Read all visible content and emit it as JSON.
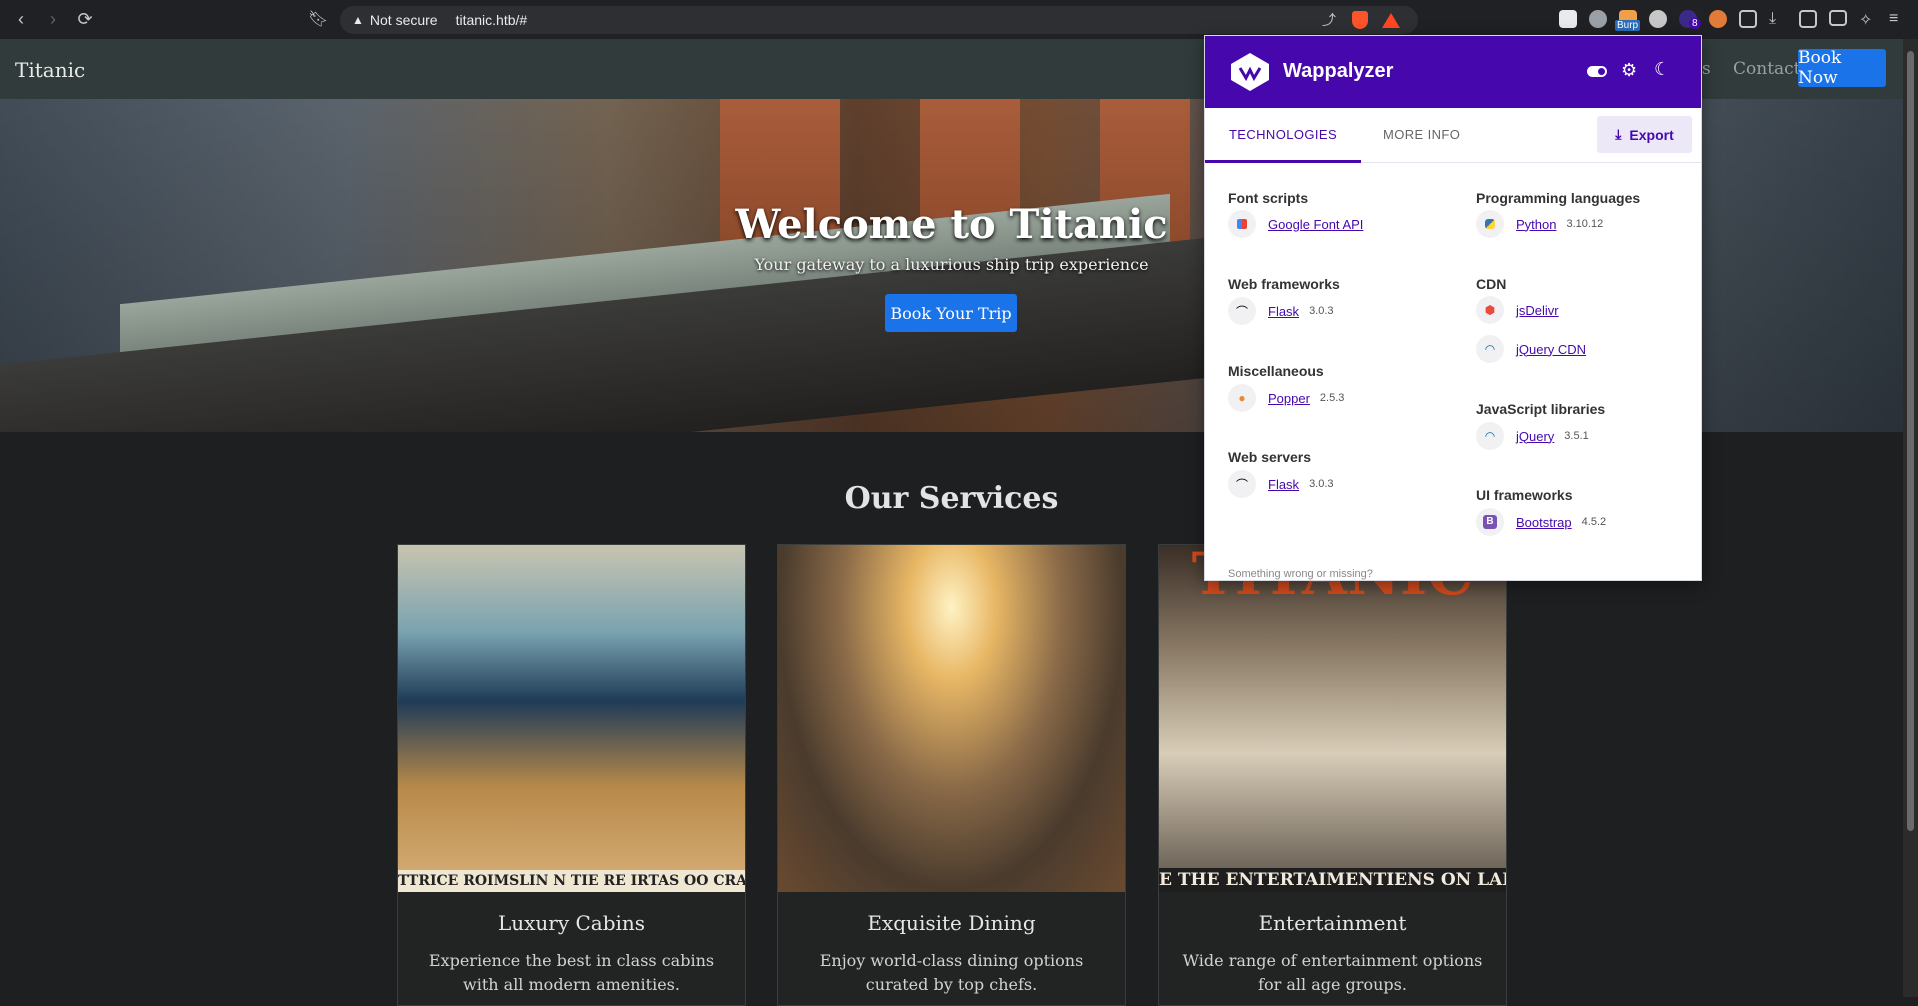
{
  "browser": {
    "security_label": "Not secure",
    "url": "titanic.htb/#",
    "ext_badge": "8",
    "ext_burp_label": "Burp"
  },
  "site": {
    "brand": "Titanic",
    "nav": {
      "partial": "es",
      "contact": "Contact",
      "book_now": "Book Now"
    },
    "hero": {
      "title": "Welcome to Titanic",
      "subtitle": "Your gateway to a luxurious ship trip experience",
      "cta": "Book Your Trip"
    },
    "services_title": "Our Services",
    "services": [
      {
        "title": "Luxury Cabins",
        "desc": "Experience the best in class cabins with all modern amenities.",
        "caption": "TTRICE ROIMSLIN N TIE RE IRTAS OO CRAS I"
      },
      {
        "title": "Exquisite Dining",
        "desc": "Enjoy world-class dining options curated by top chefs."
      },
      {
        "title": "Entertainment",
        "desc": "Wide range of entertainment options for all age groups.",
        "caption": "E THE ENTERTAIMENTIENS ON LAI",
        "banner": "TITANIC"
      }
    ]
  },
  "wappalyzer": {
    "title": "Wappalyzer",
    "tabs": {
      "technologies": "TECHNOLOGIES",
      "more_info": "MORE INFO"
    },
    "export": "Export",
    "categories": {
      "font_scripts": {
        "name": "Font scripts",
        "items": [
          {
            "name": "Google Font API",
            "version": ""
          }
        ]
      },
      "web_frameworks": {
        "name": "Web frameworks",
        "items": [
          {
            "name": "Flask",
            "version": "3.0.3"
          }
        ]
      },
      "miscellaneous": {
        "name": "Miscellaneous",
        "items": [
          {
            "name": "Popper",
            "version": "2.5.3"
          }
        ]
      },
      "web_servers": {
        "name": "Web servers",
        "items": [
          {
            "name": "Flask",
            "version": "3.0.3"
          }
        ]
      },
      "programming_languages": {
        "name": "Programming languages",
        "items": [
          {
            "name": "Python",
            "version": "3.10.12"
          }
        ]
      },
      "cdn": {
        "name": "CDN",
        "items": [
          {
            "name": "jsDelivr",
            "version": ""
          },
          {
            "name": "jQuery CDN",
            "version": ""
          }
        ]
      },
      "javascript_libraries": {
        "name": "JavaScript libraries",
        "items": [
          {
            "name": "jQuery",
            "version": "3.5.1"
          }
        ]
      },
      "ui_frameworks": {
        "name": "UI frameworks",
        "items": [
          {
            "name": "Bootstrap",
            "version": "4.5.2"
          }
        ]
      }
    },
    "footer": "Something wrong or missing?"
  }
}
